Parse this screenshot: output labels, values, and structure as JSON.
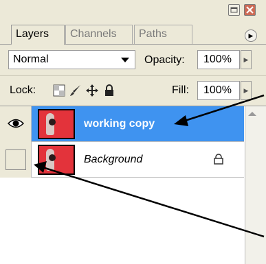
{
  "tabs": [
    {
      "label": "Layers",
      "active": true
    },
    {
      "label": "Channels",
      "active": false
    },
    {
      "label": "Paths",
      "active": false
    }
  ],
  "blend_mode": {
    "selected": "Normal"
  },
  "opacity": {
    "label": "Opacity:",
    "value": "100%"
  },
  "lock": {
    "label": "Lock:"
  },
  "fill": {
    "label": "Fill:",
    "value": "100%"
  },
  "layers": [
    {
      "name": "working copy",
      "visible": true,
      "selected": true,
      "locked": false
    },
    {
      "name": "Background",
      "visible": false,
      "selected": false,
      "locked": true
    }
  ],
  "icons": {
    "minimize": "minimize-icon",
    "close": "close-icon",
    "panel_menu": "panel-menu-icon",
    "eye": "eye-icon",
    "lock_transparent": "lock-transparent-pixels-icon",
    "lock_image": "lock-image-pixels-icon",
    "lock_position": "lock-position-icon",
    "lock_all": "lock-all-icon",
    "layer_lock": "layer-lock-icon"
  },
  "colors": {
    "selected_layer_bg": "#3f93f0",
    "panel_bg": "#ece9d8",
    "thumbnail_bg": "#e3333b",
    "close_button": "#cc6a55"
  }
}
